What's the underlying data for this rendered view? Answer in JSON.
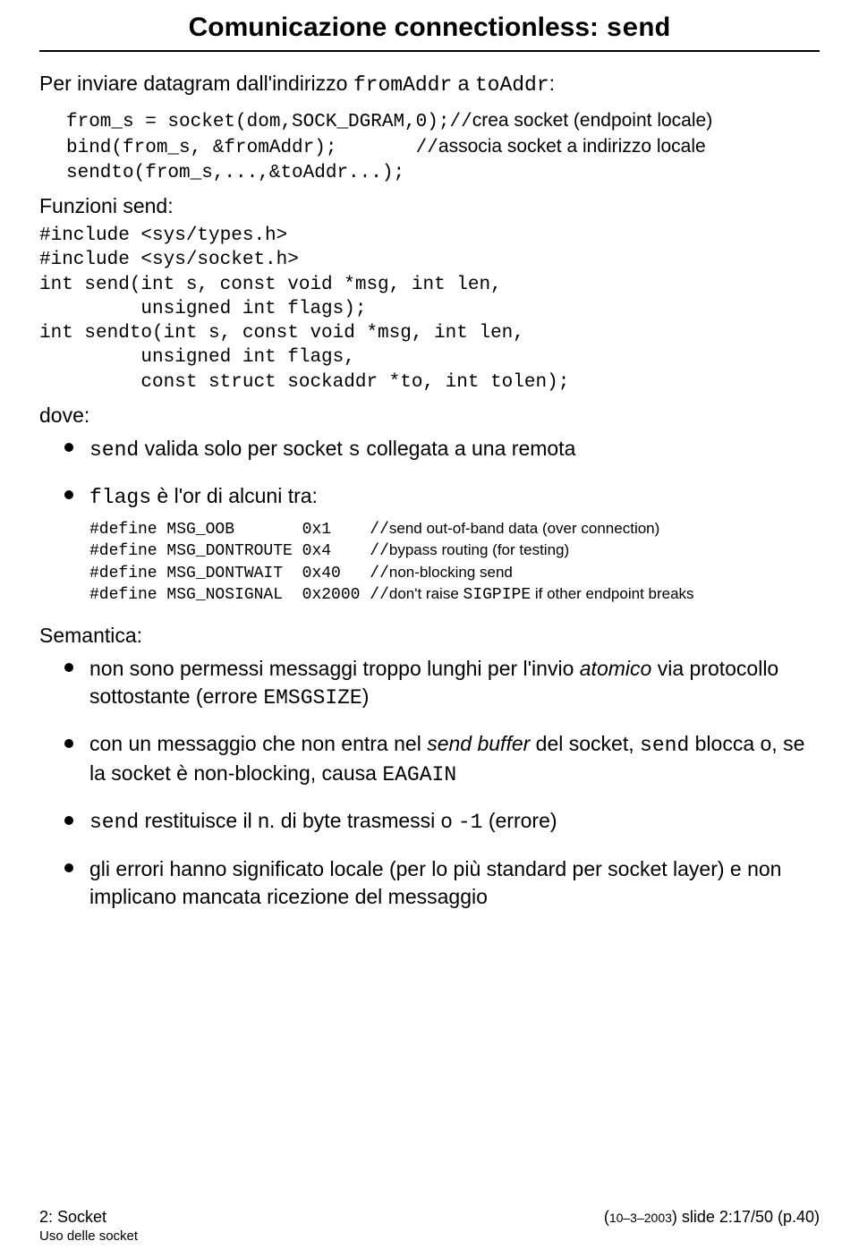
{
  "title": {
    "prefix": "Comunicazione connectionless: ",
    "mono": "send"
  },
  "intro": {
    "t1": "Per inviare datagram dall'indirizzo ",
    "m1": "fromAddr",
    "t2": " a ",
    "m2": "toAddr",
    "t3": ":"
  },
  "code1": {
    "l1a": "from_s = socket(dom,SOCK_DGRAM,0);",
    "l1c_sl": "//",
    "l1c_tx": "crea socket (endpoint locale)",
    "l2a": "bind(from_s, &fromAddr);       ",
    "l2c_sl": "//",
    "l2c_tx": "associa socket a indirizzo locale",
    "l3": "sendto(from_s,...,&toAddr...);"
  },
  "label_funzioni": "Funzioni send:",
  "code2": "#include <sys/types.h>\n#include <sys/socket.h>\nint send(int s, const void *msg, int len,\n         unsigned int flags);\nint sendto(int s, const void *msg, int len,\n         unsigned int flags,\n         const struct sockaddr *to, int tolen);",
  "label_dove": "dove:",
  "bullets_dove": {
    "b1": {
      "m1": "send",
      "t1": " valida solo per socket ",
      "m2": "s",
      "t2": " collegata a una remota"
    },
    "b2": {
      "m1": "flags",
      "t1": " è l'or di alcuni tra:"
    }
  },
  "defines": {
    "l1a": "#define MSG_OOB       0x1    ",
    "l1c_sl": "//",
    "l1c_tx": "send out-of-band data (over connection)",
    "l2a": "#define MSG_DONTROUTE 0x4    ",
    "l2c_sl": "//",
    "l2c_tx": "bypass routing (for testing)",
    "l3a": "#define MSG_DONTWAIT  0x40   ",
    "l3c_sl": "//",
    "l3c_tx": "non-blocking send",
    "l4a": "#define MSG_NOSIGNAL  0x2000 ",
    "l4c_sl": "//",
    "l4c_tx1": "don't raise ",
    "l4c_m": "SIGPIPE",
    "l4c_tx2": " if other endpoint breaks"
  },
  "label_semantica": "Semantica:",
  "bullets_sem": {
    "b1": {
      "t1": "non sono permessi messaggi troppo lunghi per l'invio ",
      "i1": "atomico",
      "t2": " via protocollo sottostante (errore ",
      "m1": "EMSGSIZE",
      "t3": ")"
    },
    "b2": {
      "t1": "con un messaggio che non entra nel ",
      "i1": "send buffer",
      "t2": " del socket, ",
      "m1": "send",
      "t3": " blocca o, se la socket è non-blocking, causa ",
      "m2": "EAGAIN"
    },
    "b3": {
      "m1": "send",
      "t1": " restituisce il n. di byte trasmessi o ",
      "m2": "-1",
      "t2": " (errore)"
    },
    "b4": {
      "t1": "gli errori hanno significato locale (per lo più standard per socket layer) e non implicano mancata ricezione del messaggio"
    }
  },
  "footer": {
    "left": "2: Socket",
    "right_date": "10–3–2003",
    "right_slide": "slide 2:17/50 (p.40)",
    "sub": "Uso delle socket"
  }
}
